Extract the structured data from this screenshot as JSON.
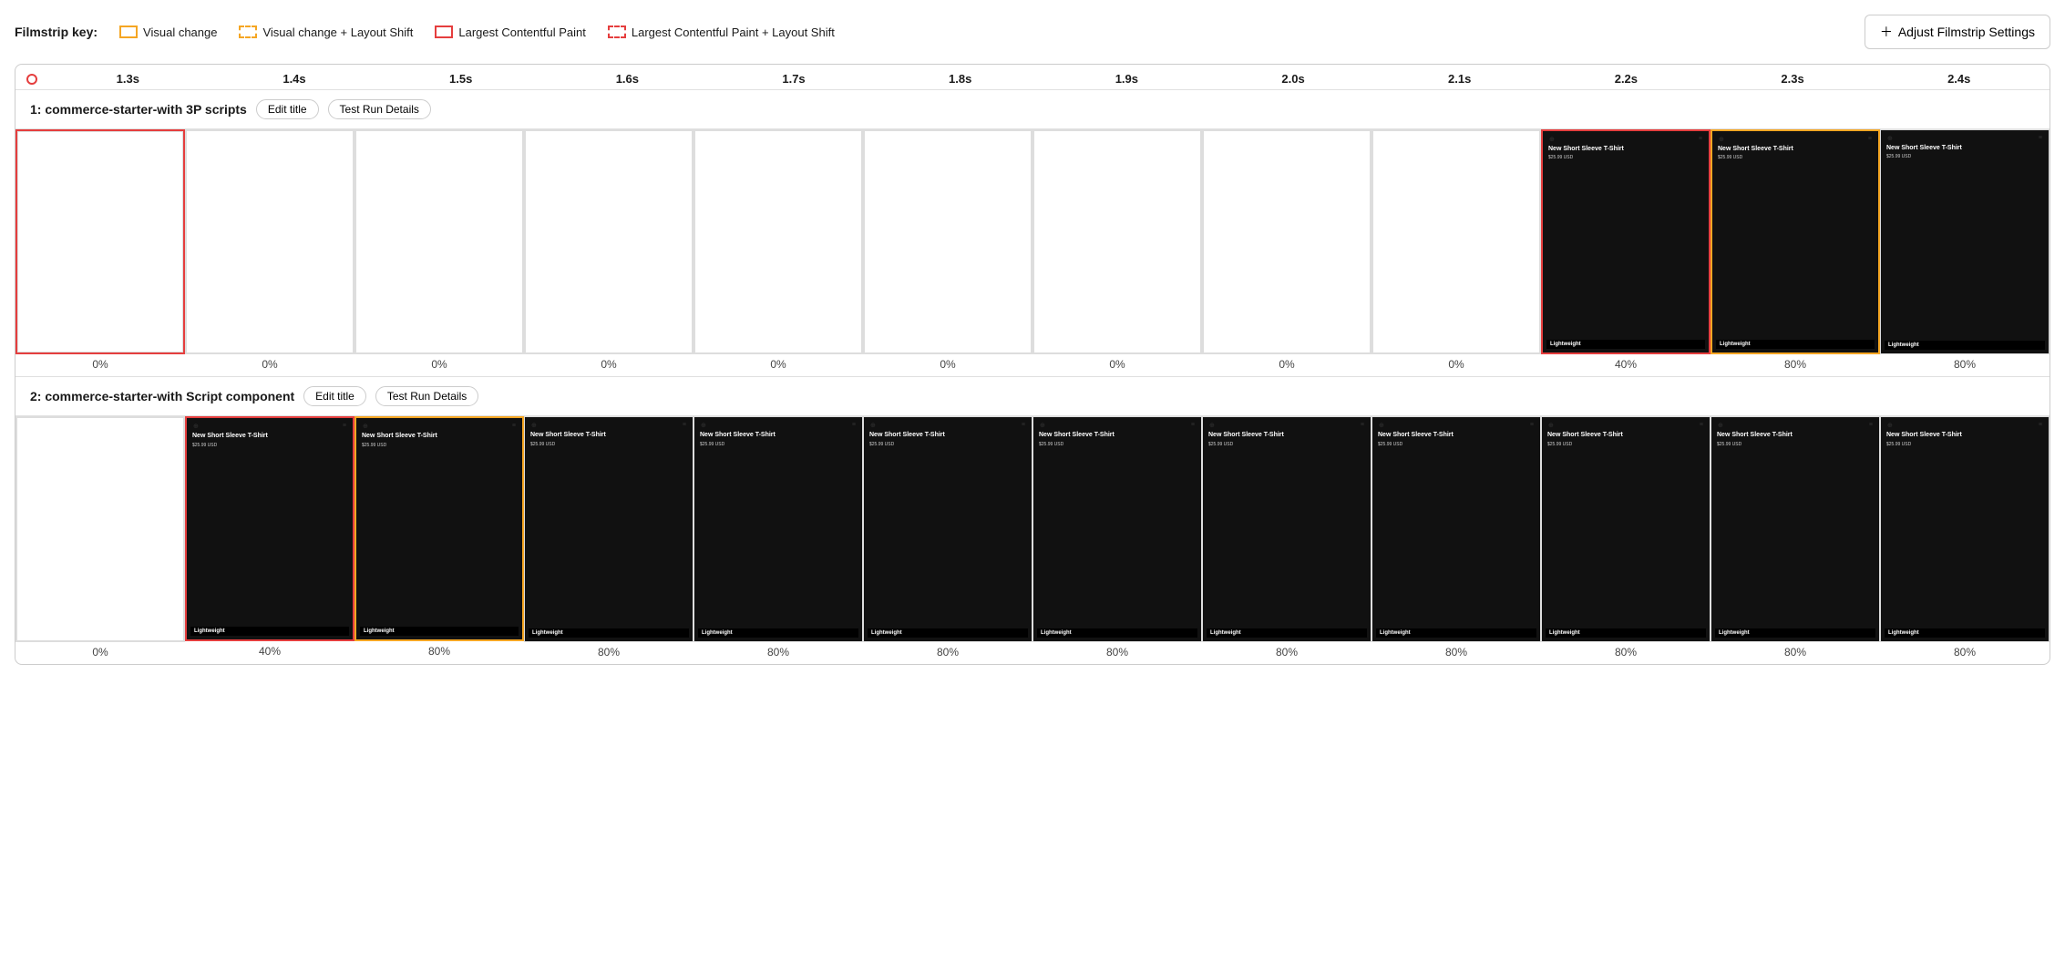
{
  "legend": {
    "title": "Filmstrip key:",
    "items": [
      {
        "id": "visual-change",
        "label": "Visual change",
        "type": "visual-change"
      },
      {
        "id": "visual-change-layout",
        "label": "Visual change + Layout Shift",
        "type": "visual-change-layout"
      },
      {
        "id": "lcp",
        "label": "Largest Contentful Paint",
        "type": "lcp"
      },
      {
        "id": "lcp-layout",
        "label": "Largest Contentful Paint + Layout Shift",
        "type": "lcp-layout"
      }
    ],
    "adjust_button": "Adjust Filmstrip Settings"
  },
  "timeline": {
    "ticks": [
      "1.3s",
      "1.4s",
      "1.5s",
      "1.6s",
      "1.7s",
      "1.8s",
      "1.9s",
      "2.0s",
      "2.1s",
      "2.2s",
      "2.3s",
      "2.4s"
    ]
  },
  "rows": [
    {
      "id": "row-1",
      "title": "1: commerce-starter-with 3P scripts",
      "edit_title_label": "Edit title",
      "test_run_label": "Test Run Details",
      "frames": [
        {
          "id": "f1-1",
          "blank": true,
          "border": "red",
          "percent": "0%"
        },
        {
          "id": "f1-2",
          "blank": true,
          "border": "none",
          "percent": "0%"
        },
        {
          "id": "f1-3",
          "blank": true,
          "border": "none",
          "percent": "0%"
        },
        {
          "id": "f1-4",
          "blank": true,
          "border": "none",
          "percent": "0%"
        },
        {
          "id": "f1-5",
          "blank": true,
          "border": "none",
          "percent": "0%"
        },
        {
          "id": "f1-6",
          "blank": true,
          "border": "none",
          "percent": "0%"
        },
        {
          "id": "f1-7",
          "blank": true,
          "border": "none",
          "percent": "0%"
        },
        {
          "id": "f1-8",
          "blank": true,
          "border": "none",
          "percent": "0%"
        },
        {
          "id": "f1-9",
          "blank": true,
          "border": "none",
          "percent": "0%"
        },
        {
          "id": "f1-10",
          "blank": false,
          "border": "red",
          "percent": "40%"
        },
        {
          "id": "f1-11",
          "blank": false,
          "border": "orange",
          "percent": "80%"
        },
        {
          "id": "f1-12",
          "blank": false,
          "border": "none",
          "percent": "80%"
        }
      ]
    },
    {
      "id": "row-2",
      "title": "2: commerce-starter-with Script component",
      "edit_title_label": "Edit title",
      "test_run_label": "Test Run Details",
      "frames": [
        {
          "id": "f2-1",
          "blank": true,
          "border": "none",
          "percent": "0%"
        },
        {
          "id": "f2-2",
          "blank": false,
          "border": "red",
          "percent": "40%"
        },
        {
          "id": "f2-3",
          "blank": false,
          "border": "orange",
          "percent": "80%"
        },
        {
          "id": "f2-4",
          "blank": false,
          "border": "none",
          "percent": "80%"
        },
        {
          "id": "f2-5",
          "blank": false,
          "border": "none",
          "percent": "80%"
        },
        {
          "id": "f2-6",
          "blank": false,
          "border": "none",
          "percent": "80%"
        },
        {
          "id": "f2-7",
          "blank": false,
          "border": "none",
          "percent": "80%"
        },
        {
          "id": "f2-8",
          "blank": false,
          "border": "none",
          "percent": "80%"
        },
        {
          "id": "f2-9",
          "blank": false,
          "border": "none",
          "percent": "80%"
        },
        {
          "id": "f2-10",
          "blank": false,
          "border": "none",
          "percent": "80%"
        },
        {
          "id": "f2-11",
          "blank": false,
          "border": "none",
          "percent": "80%"
        },
        {
          "id": "f2-12",
          "blank": false,
          "border": "none",
          "percent": "80%"
        }
      ]
    }
  ]
}
